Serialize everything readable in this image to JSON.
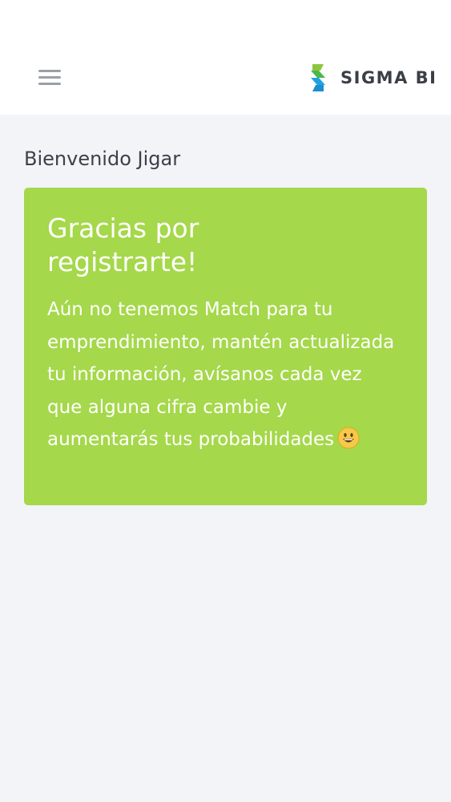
{
  "header": {
    "brand_name": "SIGMA BI",
    "brand_colors": {
      "accent_green": "#8cc63f",
      "accent_blue": "#1fa2e0"
    }
  },
  "main": {
    "welcome_text": "Bienvenido Jigar",
    "card": {
      "title": "Gracias por registrarte!",
      "body": "Aún no tenemos Match para tu emprendimiento, mantén actualizada tu información, avísanos cada vez que alguna cifra cambie y aumentarás tus probabilidades",
      "emoji": "smiling-face-emoji",
      "background_color": "#a5d84a"
    }
  },
  "icons": {
    "menu": "hamburger-menu-icon",
    "logo": "sigma-bi-logo-icon"
  }
}
